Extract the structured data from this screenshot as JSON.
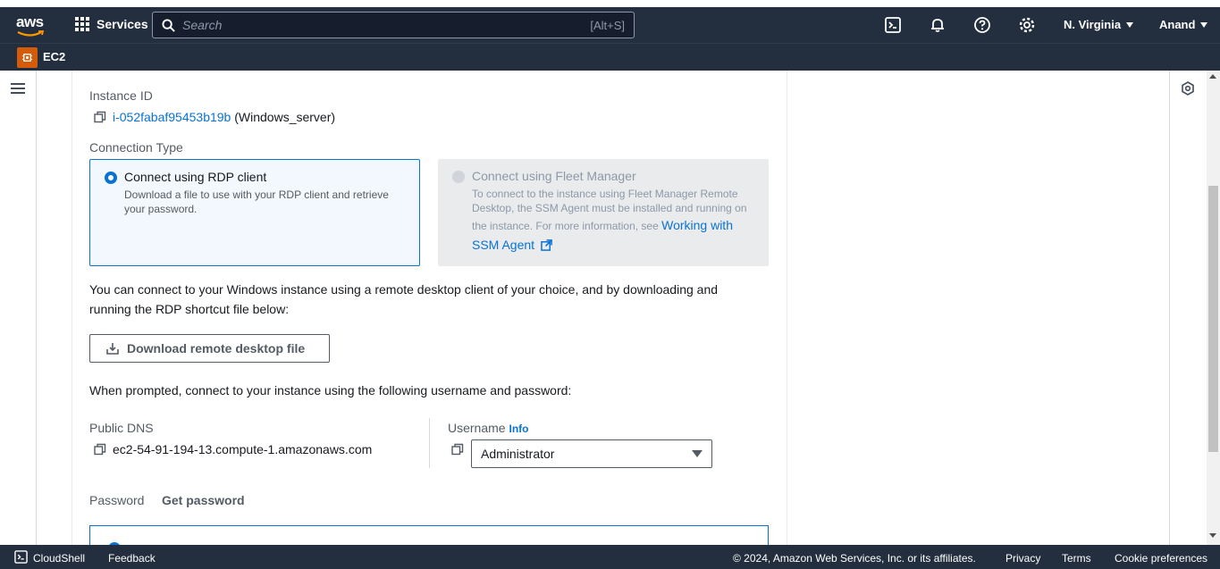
{
  "topnav": {
    "logo_text": "aws",
    "services_label": "Services",
    "search_placeholder": "Search",
    "search_shortcut": "[Alt+S]",
    "region_label": "N. Virginia",
    "user_label": "Anand"
  },
  "subnav": {
    "service_name": "EC2"
  },
  "instance": {
    "id_label": "Instance ID",
    "id_link": "i-052fabaf95453b19b",
    "name_suffix": "(Windows_server)"
  },
  "connection": {
    "type_label": "Connection Type",
    "option_rdp_title": "Connect using RDP client",
    "option_rdp_desc": "Download a file to use with your RDP client and retrieve your password.",
    "option_fleet_title": "Connect using Fleet Manager",
    "option_fleet_desc": "To connect to the instance using Fleet Manager Remote Desktop, the SSM Agent must be installed and running on the instance. For more information, see",
    "option_fleet_link": "Working with SSM Agent",
    "selected": "Connect using RDP client"
  },
  "instructions": {
    "line1": "You can connect to your Windows instance using a remote desktop client of your choice, and by downloading and running the RDP shortcut file below:",
    "download_button": "Download remote desktop file",
    "line2": "When prompted, connect to your instance using the following username and password:"
  },
  "dns": {
    "label": "Public DNS",
    "value": "ec2-54-91-194-13.compute-1.amazonaws.com"
  },
  "username": {
    "label": "Username",
    "info": "Info",
    "value": "Administrator"
  },
  "password": {
    "label": "Password",
    "action": "Get password"
  },
  "footer": {
    "cloudshell": "CloudShell",
    "feedback": "Feedback",
    "copyright": "© 2024, Amazon Web Services, Inc. or its affiliates.",
    "privacy": "Privacy",
    "terms": "Terms",
    "cookies": "Cookie preferences"
  },
  "colors": {
    "nav_bg": "#232f3e",
    "link": "#0972d3",
    "ec2_badge": "#d45b07"
  }
}
